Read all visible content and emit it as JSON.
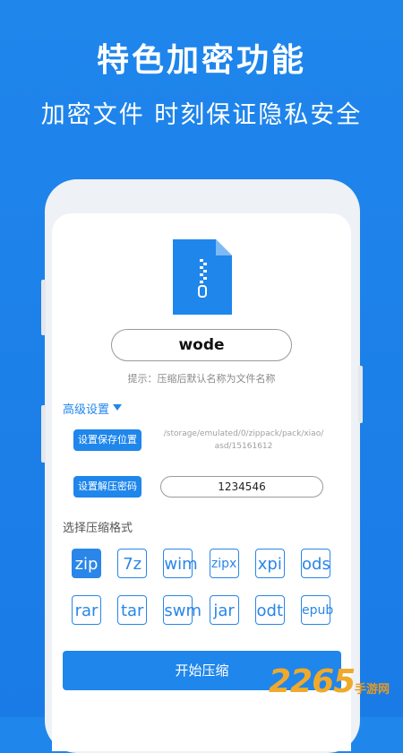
{
  "banner": {
    "title": "特色加密功能",
    "subtitle": "加密文件 时刻保证隐私安全"
  },
  "compress": {
    "file_name": "wode",
    "hint": "提示：压缩后默认名称为文件名称",
    "advanced_label": "高级设置",
    "save_location_button": "设置保存位置",
    "save_path_line1": "/storage/emulated/0/zippack/pack/xiao/",
    "save_path_line2": "asd/15161612",
    "password_button": "设置解压密码",
    "password_value": "1234546",
    "format_label": "选择压缩格式",
    "formats_row1": [
      "zip",
      "7z",
      "wim",
      "zipx",
      "xpi",
      "ods"
    ],
    "formats_row2": [
      "rar",
      "tar",
      "swm",
      "jar",
      "odt",
      "epub"
    ],
    "selected_format": "zip",
    "start_button": "开始压缩"
  },
  "watermark": {
    "number": "2265",
    "suffix": "手游网"
  },
  "colors": {
    "accent": "#1f86ec",
    "background": "#1a7be6",
    "watermark": "#f0a92a"
  }
}
